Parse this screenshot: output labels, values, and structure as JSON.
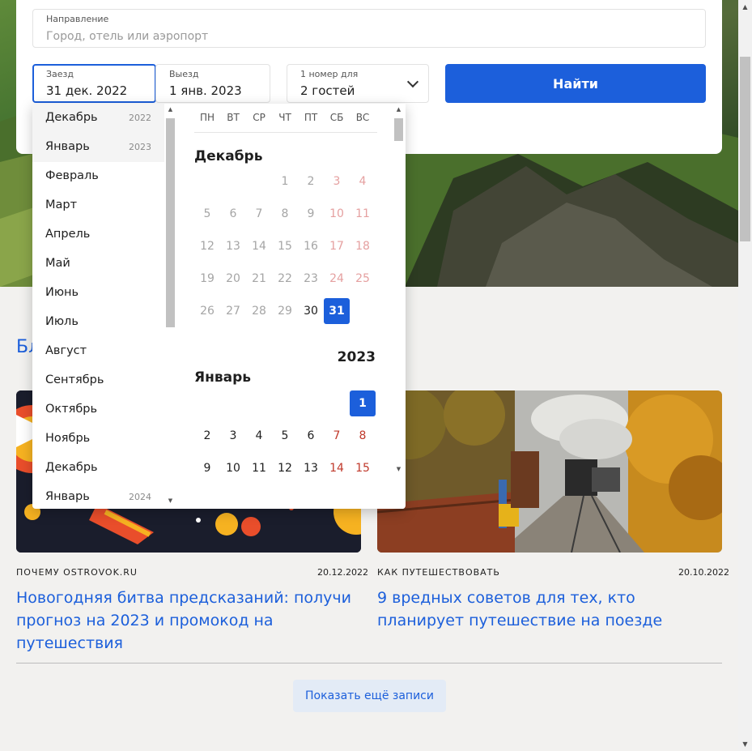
{
  "search": {
    "destination_label": "Направление",
    "destination_placeholder": "Город, отель или аэропорт",
    "checkin_label": "Заезд",
    "checkin_value": "31 дек. 2022",
    "checkout_label": "Выезд",
    "checkout_value": "1 янв. 2023",
    "guests_label": "1 номер для",
    "guests_value": "2 гостей",
    "find_label": "Найти"
  },
  "month_list": [
    {
      "name": "Декабрь",
      "year": "2022"
    },
    {
      "name": "Январь",
      "year": "2023"
    },
    {
      "name": "Февраль",
      "year": ""
    },
    {
      "name": "Март",
      "year": ""
    },
    {
      "name": "Апрель",
      "year": ""
    },
    {
      "name": "Май",
      "year": ""
    },
    {
      "name": "Июнь",
      "year": ""
    },
    {
      "name": "Июль",
      "year": ""
    },
    {
      "name": "Август",
      "year": ""
    },
    {
      "name": "Сентябрь",
      "year": ""
    },
    {
      "name": "Октябрь",
      "year": ""
    },
    {
      "name": "Ноябрь",
      "year": ""
    },
    {
      "name": "Декабрь",
      "year": ""
    },
    {
      "name": "Январь",
      "year": "2024"
    }
  ],
  "weekdays": [
    "ПН",
    "ВТ",
    "СР",
    "ЧТ",
    "ПТ",
    "СБ",
    "ВС"
  ],
  "calendar": {
    "december_title": "Декабрь",
    "year_2023": "2023",
    "january_title": "Январь",
    "december_days": [
      "1",
      "2",
      "3",
      "4",
      "5",
      "6",
      "7",
      "8",
      "9",
      "10",
      "11",
      "12",
      "13",
      "14",
      "15",
      "16",
      "17",
      "18",
      "19",
      "20",
      "21",
      "22",
      "23",
      "24",
      "25",
      "26",
      "27",
      "28",
      "29",
      "30",
      "31"
    ],
    "january_days": [
      "1",
      "2",
      "3",
      "4",
      "5",
      "6",
      "7",
      "8",
      "9",
      "10",
      "11",
      "12",
      "13",
      "14",
      "15"
    ],
    "selected_checkin": "31",
    "selected_checkout": "1"
  },
  "blog": {
    "title_partial": "Бл",
    "posts": [
      {
        "category": "ПОЧЕМУ OSTROVOK.RU",
        "date": "20.12.2022",
        "title": "Новогодняя битва предсказаний: получи прогноз на 2023 и промокод на путешествия"
      },
      {
        "category": "КАК ПУТЕШЕСТВОВАТЬ",
        "date": "20.10.2022",
        "title": "9 вредных советов для тех, кто планирует путешествие на поезде"
      }
    ],
    "more_label": "Показать ещё записи"
  },
  "colors": {
    "accent": "#1c5fdb",
    "weekend": "#c0392b"
  },
  "icons": [
    "chevron-down-icon",
    "scroll-up-arrow-icon",
    "scroll-down-arrow-icon"
  ]
}
